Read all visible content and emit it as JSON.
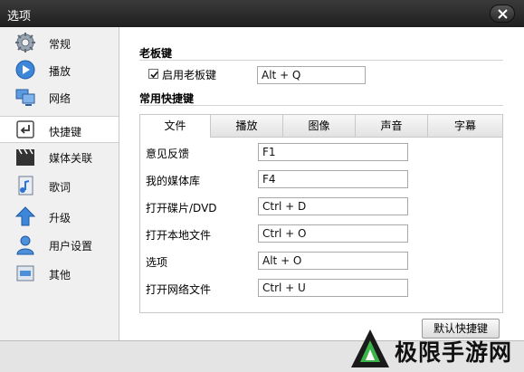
{
  "window": {
    "title": "选项"
  },
  "sidebar": {
    "items": [
      {
        "label": "常规",
        "icon": "gear-icon"
      },
      {
        "label": "播放",
        "icon": "play-icon"
      },
      {
        "label": "网络",
        "icon": "network-icon"
      },
      {
        "label": "快捷键",
        "icon": "shortcut-icon",
        "active": true
      },
      {
        "label": "媒体关联",
        "icon": "clapper-icon"
      },
      {
        "label": "歌词",
        "icon": "lyrics-icon"
      },
      {
        "label": "升级",
        "icon": "upgrade-arrow-icon"
      },
      {
        "label": "用户设置",
        "icon": "user-icon"
      },
      {
        "label": "其他",
        "icon": "etc-icon"
      }
    ]
  },
  "boss_key": {
    "section_title": "老板键",
    "checkbox_label": "启用老板键",
    "checked": true,
    "value": "Alt + Q"
  },
  "shortcuts": {
    "section_title": "常用快捷键",
    "tabs": [
      "文件",
      "播放",
      "图像",
      "声音",
      "字幕"
    ],
    "active_tab": 0,
    "rows": [
      {
        "label": "意见反馈",
        "value": "F1"
      },
      {
        "label": "我的媒体库",
        "value": "F4"
      },
      {
        "label": "打开碟片/DVD",
        "value": "Ctrl + D"
      },
      {
        "label": "打开本地文件",
        "value": "Ctrl + O"
      },
      {
        "label": "选项",
        "value": "Alt + O"
      },
      {
        "label": "打开网络文件",
        "value": "Ctrl + U"
      }
    ],
    "default_button": "默认快捷键"
  },
  "watermark": {
    "text": "极限手游网"
  },
  "colors": {
    "titlebar": "#2a2a2a",
    "sidebar_bg": "#f0f0f0",
    "accent_blue": "#2b74d6"
  }
}
